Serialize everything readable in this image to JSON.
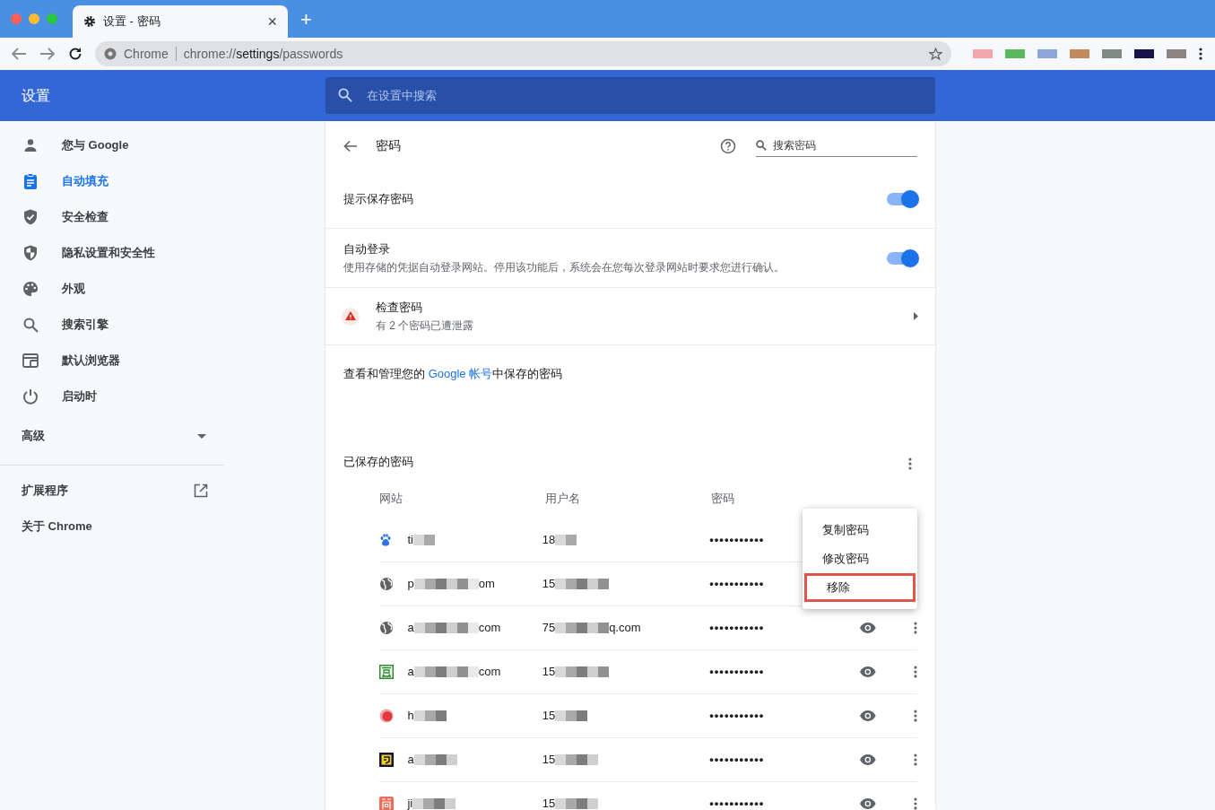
{
  "browser": {
    "tab": {
      "title": "设置 - 密码",
      "close": "×"
    },
    "new_tab": "+",
    "address": {
      "origin": "Chrome",
      "url_pre": "chrome://",
      "url_host": "settings",
      "url_path": "/passwords"
    },
    "extensions": [
      {
        "color": "#f4a6ab"
      },
      {
        "color": "#5cb85c"
      },
      {
        "color": "#8fa6d8"
      },
      {
        "color": "#c08a5a"
      },
      {
        "color": "#7f8a82"
      },
      {
        "color": "#14124a"
      },
      {
        "color": "#8a8484"
      }
    ]
  },
  "header": {
    "title": "设置",
    "search_placeholder": "在设置中搜索"
  },
  "sidebar": {
    "items": [
      {
        "label": "您与 Google",
        "selected": false
      },
      {
        "label": "自动填充",
        "selected": true
      },
      {
        "label": "安全检查",
        "selected": false
      },
      {
        "label": "隐私设置和安全性",
        "selected": false
      },
      {
        "label": "外观",
        "selected": false
      },
      {
        "label": "搜索引擎",
        "selected": false
      },
      {
        "label": "默认浏览器",
        "selected": false
      },
      {
        "label": "启动时",
        "selected": false
      }
    ],
    "advanced": "高级",
    "extensions": "扩展程序",
    "about": "关于 Chrome"
  },
  "page": {
    "title": "密码",
    "search_placeholder": "搜索密码",
    "settings": [
      {
        "label": "提示保存密码",
        "on": true
      },
      {
        "label": "自动登录",
        "description": "使用存储的凭据自动登录网站。停用该功能后，系统会在您每次登录网站时要求您进行确认。",
        "on": true
      }
    ],
    "check": {
      "title": "检查密码",
      "subtitle": "有 2 个密码已遭泄露"
    },
    "manage_pre": "查看和管理您的 ",
    "manage_link": "Google 帐号",
    "manage_post": "中保存的密码",
    "saved_title": "已保存的密码",
    "columns": [
      "网站",
      "用户名",
      "密码"
    ],
    "rows": [
      {
        "kind": "paw",
        "site": [
          "ti"
        ],
        "user": [
          "18"
        ],
        "password": "•••••••••••"
      },
      {
        "kind": "globe",
        "site": [
          "p",
          "om"
        ],
        "user": [
          "15"
        ],
        "password": "•••••••••••"
      },
      {
        "kind": "globe",
        "site": [
          "a",
          "com"
        ],
        "user": [
          "75",
          "q.com"
        ],
        "password": "•••••••••••"
      },
      {
        "kind": "green",
        "site": [
          "a",
          "com"
        ],
        "user": [
          "15"
        ],
        "password": "•••••••••••"
      },
      {
        "kind": "red",
        "site": [
          "h"
        ],
        "user": [
          "15"
        ],
        "password": "•••••••••••"
      },
      {
        "kind": "yellow",
        "site": [
          "a"
        ],
        "user": [
          "15"
        ],
        "password": "•••••••••••"
      },
      {
        "kind": "orange",
        "site": [
          "ji"
        ],
        "user": [
          "15"
        ],
        "password": "•••••••••••"
      }
    ],
    "menu": {
      "items": [
        {
          "label": "复制密码",
          "highlighted": false
        },
        {
          "label": "修改密码",
          "highlighted": false
        },
        {
          "label": "移除",
          "highlighted": true
        }
      ]
    }
  }
}
